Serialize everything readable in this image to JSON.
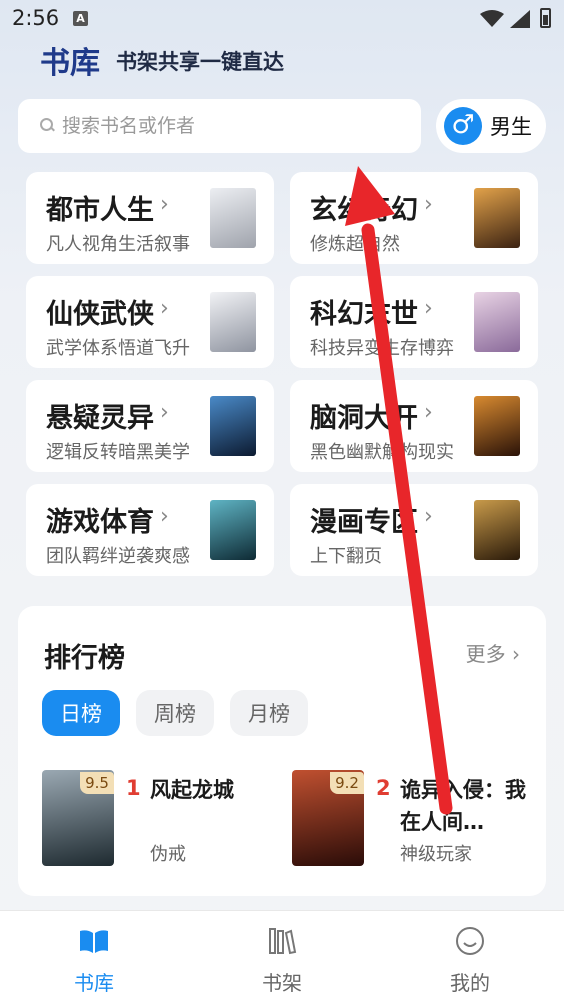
{
  "status_bar": {
    "time": "2:56",
    "notification_icon": "A"
  },
  "header": {
    "brand": "书库",
    "slogan": "书架共享一键直达"
  },
  "search": {
    "placeholder": "搜索书名或作者"
  },
  "gender": {
    "symbol": "♂",
    "label": "男生"
  },
  "categories": [
    {
      "title": "都市人生",
      "subtitle": "凡人视角生活叙事",
      "cover_color": "#c9ccd4"
    },
    {
      "title": "玄幻奇幻",
      "subtitle": "修炼超自然",
      "cover_color": "#a86c2a"
    },
    {
      "title": "仙侠武侠",
      "subtitle": "武学体系悟道飞升",
      "cover_color": "#b8bcc6"
    },
    {
      "title": "科幻末世",
      "subtitle": "科技异变生存博弈",
      "cover_color": "#c7a9c6"
    },
    {
      "title": "悬疑灵异",
      "subtitle": "逻辑反转暗黑美学",
      "cover_color": "#1e3a5f"
    },
    {
      "title": "脑洞大开",
      "subtitle": "黑色幽默解构现实",
      "cover_color": "#7a3a12"
    },
    {
      "title": "游戏体育",
      "subtitle": "团队羁绊逆袭爽感",
      "cover_color": "#1d5a6a"
    },
    {
      "title": "漫画专区",
      "subtitle": "上下翻页",
      "cover_color": "#6b4a1e"
    }
  ],
  "ranking": {
    "title": "排行榜",
    "more_label": "更多",
    "tabs": [
      {
        "label": "日榜",
        "active": true
      },
      {
        "label": "周榜",
        "active": false
      },
      {
        "label": "月榜",
        "active": false
      }
    ],
    "books": [
      {
        "rank": "1",
        "score": "9.5",
        "name": "风起龙城",
        "author": "伪戒",
        "cover_color": "#3a4a55"
      },
      {
        "rank": "2",
        "score": "9.2",
        "name": "诡异入侵：我在人间…",
        "author": "神级玩家",
        "cover_color": "#5a2418"
      }
    ]
  },
  "nav": [
    {
      "label": "书库",
      "active": true,
      "icon": "book-open-icon"
    },
    {
      "label": "书架",
      "active": false,
      "icon": "bookshelf-icon"
    },
    {
      "label": "我的",
      "active": false,
      "icon": "smiley-icon"
    }
  ],
  "colors": {
    "accent": "#1a8cf0",
    "rank_number": "#e03d32",
    "brand": "#1f3a8a",
    "annotation_arrow": "#e8262a"
  }
}
